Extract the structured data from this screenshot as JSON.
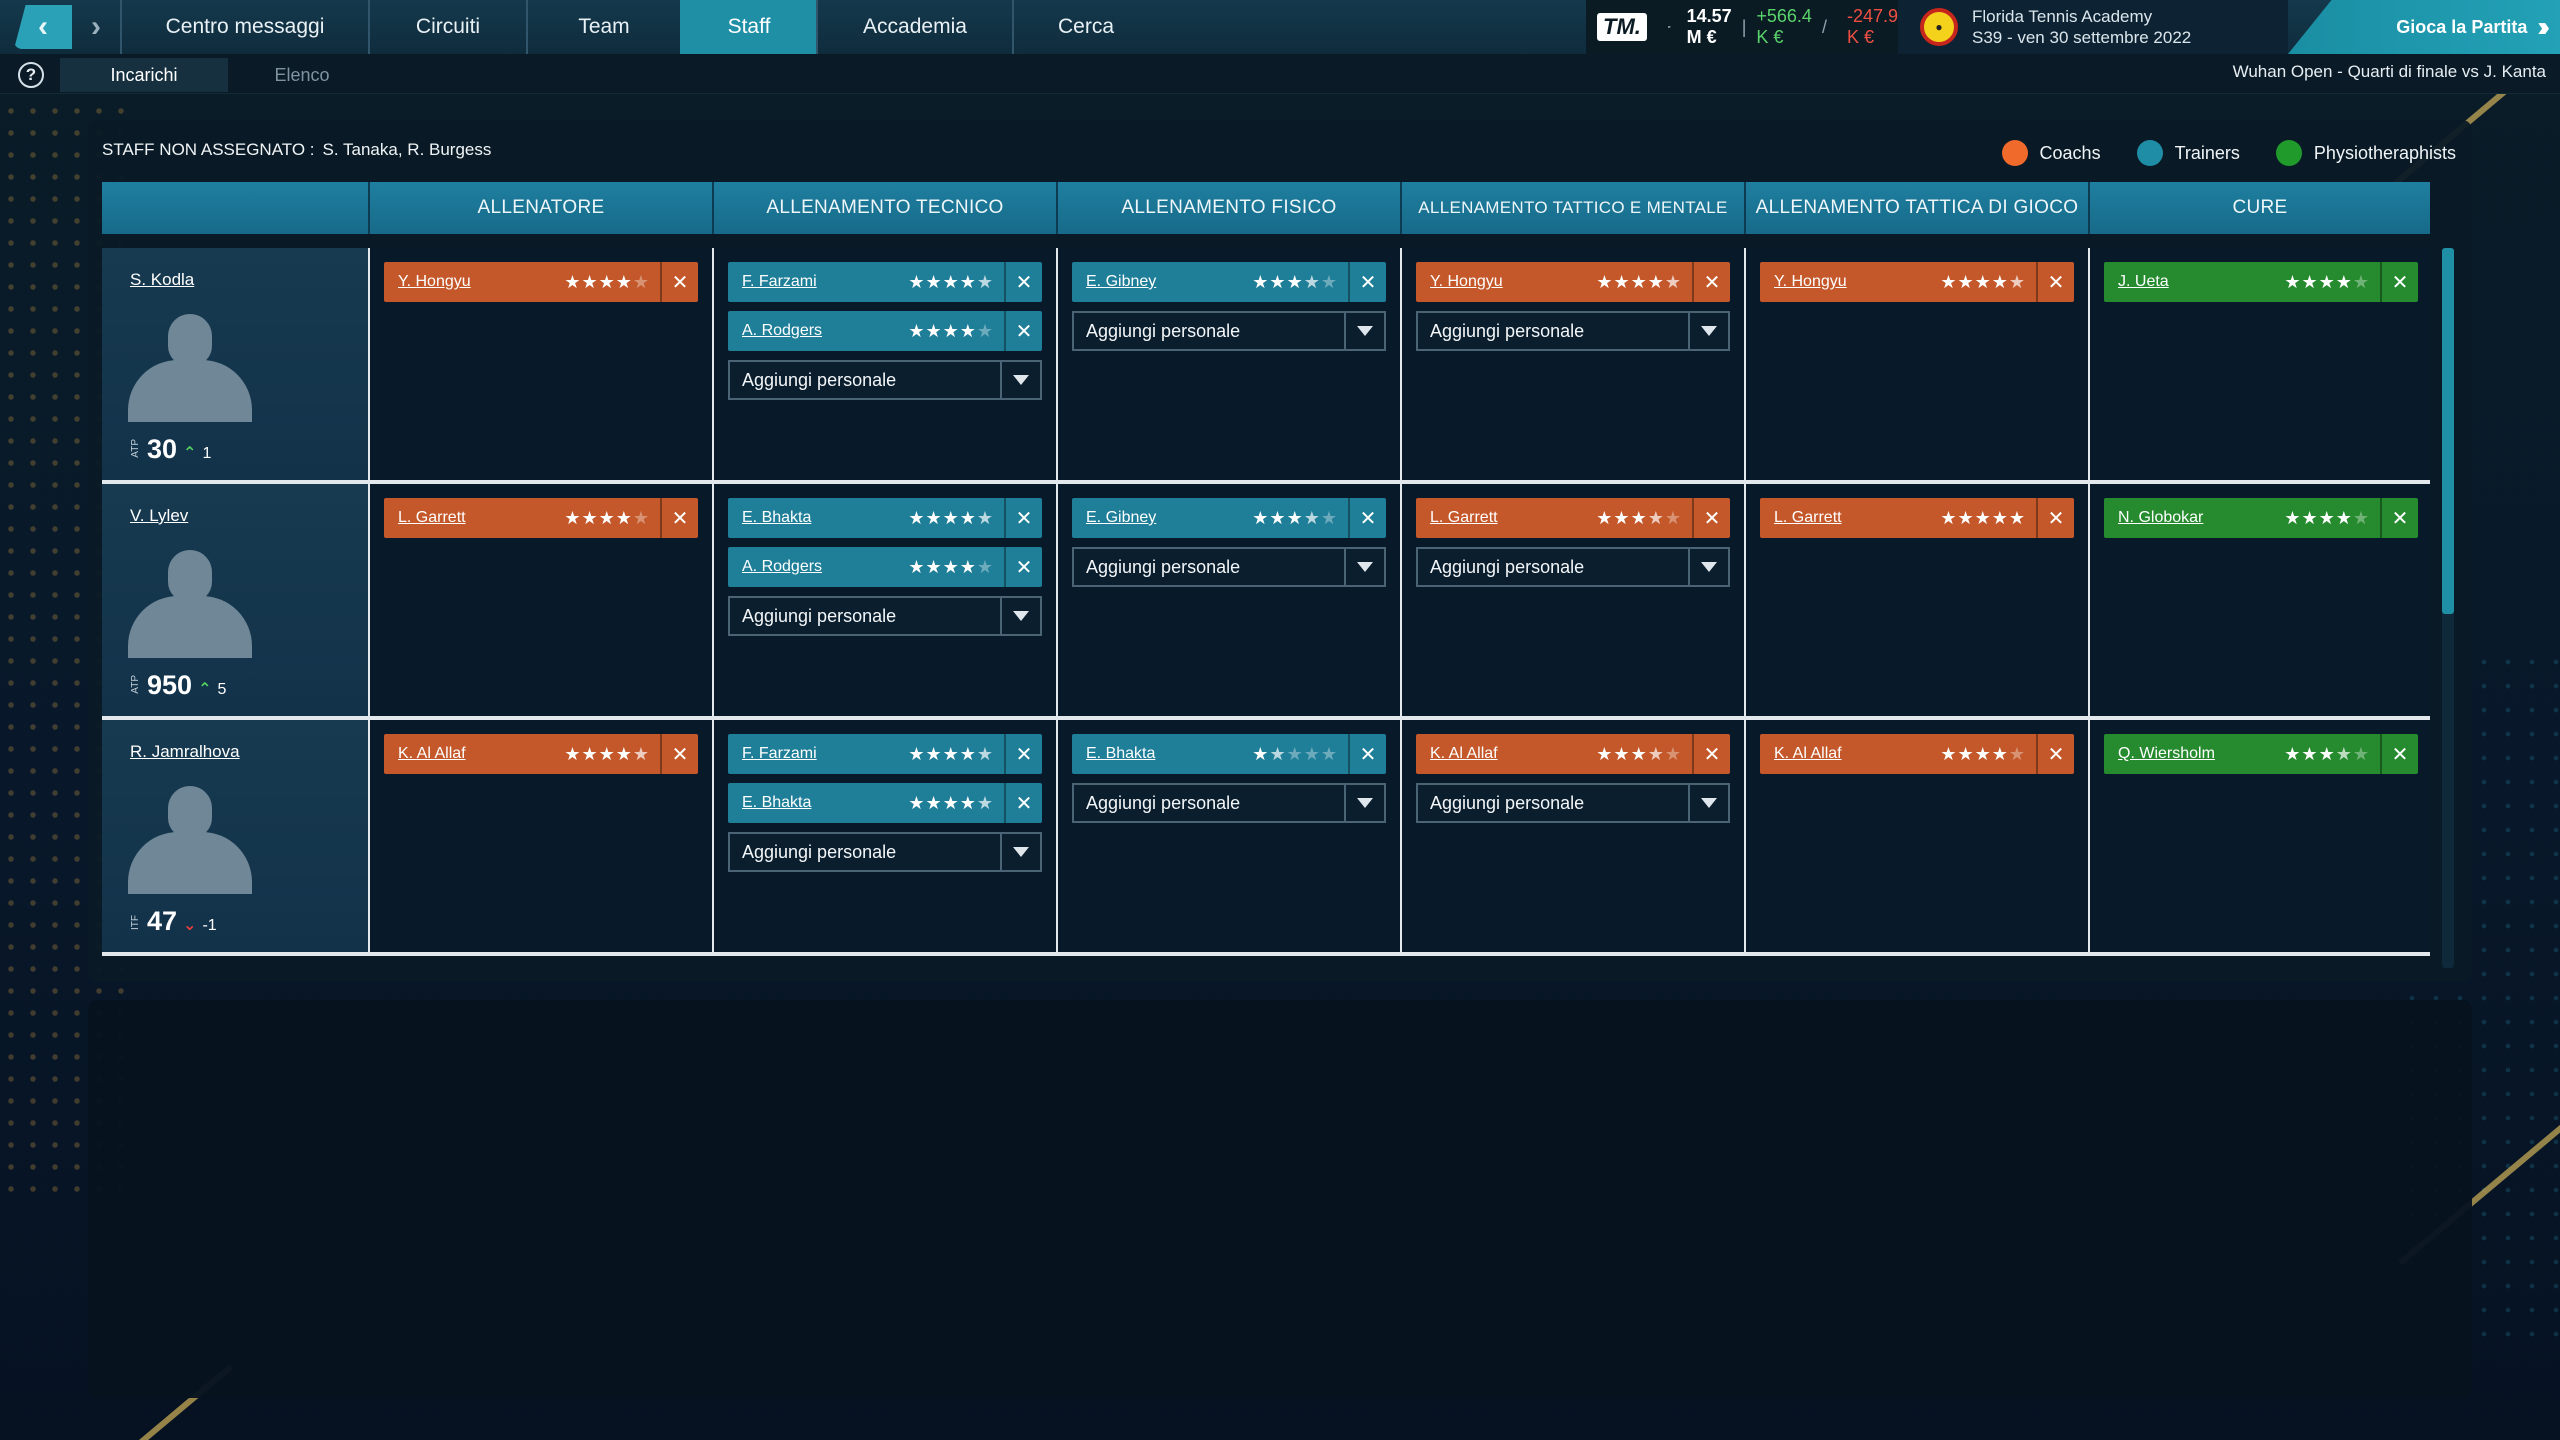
{
  "topbar": {
    "menu": [
      "Centro messaggi",
      "Circuiti",
      "Team",
      "Staff",
      "Accademia",
      "Cerca"
    ],
    "active_menu": "Staff",
    "logo_text": "TM.",
    "balance": "14.57 M €",
    "separator": "|",
    "income": "+566.4 K €",
    "slash": "/",
    "expenses": "-247.9 K €",
    "academy_name": "Florida Tennis Academy",
    "date": "S39 - ven 30 settembre 2022",
    "play_label": "Gioca la Partita"
  },
  "subbar": {
    "help": "?",
    "tab_active": "Incarichi",
    "tab_inactive": "Elenco",
    "match_info": "Wuhan Open - Quarti di finale vs J. Kanta"
  },
  "unassigned": {
    "label": "STAFF NON ASSEGNATO :",
    "names": "S. Tanaka, R. Burgess"
  },
  "legend": [
    {
      "label": "Coachs",
      "color": "#ef6a2b"
    },
    {
      "label": "Trainers",
      "color": "#1f8da6"
    },
    {
      "label": "Physiotheraphists",
      "color": "#1f9a2b"
    }
  ],
  "columns": [
    "",
    "ALLENATORE",
    "ALLENAMENTO TECNICO",
    "ALLENAMENTO FISICO",
    "ALLENAMENTO TATTICO E MENTALE",
    "ALLENAMENTO TATTICA DI GIOCO",
    "CURE"
  ],
  "add_label": "Aggiungi personale",
  "rows": [
    {
      "player": "S. Kodla",
      "rank_label": "ATP",
      "rank": "30",
      "trend": "up",
      "change": "1",
      "cells": [
        {
          "chips": [
            {
              "name": "Y. Hongyu",
              "type": "coach",
              "rating": 4
            }
          ],
          "add": false
        },
        {
          "chips": [
            {
              "name": "F. Farzami",
              "type": "trainer",
              "rating": 4.5
            },
            {
              "name": "A. Rodgers",
              "type": "trainer",
              "rating": 4
            }
          ],
          "add": true
        },
        {
          "chips": [
            {
              "name": "E. Gibney",
              "type": "trainer",
              "rating": 3.5
            }
          ],
          "add": true
        },
        {
          "chips": [
            {
              "name": "Y. Hongyu",
              "type": "coach",
              "rating": 4.5
            }
          ],
          "add": true
        },
        {
          "chips": [
            {
              "name": "Y. Hongyu",
              "type": "coach",
              "rating": 4.5
            }
          ],
          "add": false
        },
        {
          "chips": [
            {
              "name": "J. Ueta",
              "type": "physio",
              "rating": 4
            }
          ],
          "add": false
        }
      ]
    },
    {
      "player": "V. Lylev",
      "rank_label": "ATP",
      "rank": "950",
      "trend": "up",
      "change": "5",
      "cells": [
        {
          "chips": [
            {
              "name": "L. Garrett",
              "type": "coach",
              "rating": 4
            }
          ],
          "add": false
        },
        {
          "chips": [
            {
              "name": "E. Bhakta",
              "type": "trainer",
              "rating": 4.5
            },
            {
              "name": "A. Rodgers",
              "type": "trainer",
              "rating": 4
            }
          ],
          "add": true
        },
        {
          "chips": [
            {
              "name": "E. Gibney",
              "type": "trainer",
              "rating": 3.5
            }
          ],
          "add": true
        },
        {
          "chips": [
            {
              "name": "L. Garrett",
              "type": "coach",
              "rating": 3.5
            }
          ],
          "add": true
        },
        {
          "chips": [
            {
              "name": "L. Garrett",
              "type": "coach",
              "rating": 5
            }
          ],
          "add": false
        },
        {
          "chips": [
            {
              "name": "N. Globokar",
              "type": "physio",
              "rating": 4
            }
          ],
          "add": false
        }
      ]
    },
    {
      "player": "R. Jamralhova",
      "rank_label": "ITF",
      "rank": "47",
      "trend": "down",
      "change": "-1",
      "cells": [
        {
          "chips": [
            {
              "name": "K. Al Allaf",
              "type": "coach",
              "rating": 4.5
            }
          ],
          "add": false
        },
        {
          "chips": [
            {
              "name": "F. Farzami",
              "type": "trainer",
              "rating": 4.5
            },
            {
              "name": "E. Bhakta",
              "type": "trainer",
              "rating": 4.5
            }
          ],
          "add": true
        },
        {
          "chips": [
            {
              "name": "E. Bhakta",
              "type": "trainer",
              "rating": 1.5
            }
          ],
          "add": true
        },
        {
          "chips": [
            {
              "name": "K. Al Allaf",
              "type": "coach",
              "rating": 3.5
            }
          ],
          "add": true
        },
        {
          "chips": [
            {
              "name": "K. Al Allaf",
              "type": "coach",
              "rating": 4
            }
          ],
          "add": false
        },
        {
          "chips": [
            {
              "name": "Q. Wiersholm",
              "type": "physio",
              "rating": 3.5
            }
          ],
          "add": false
        }
      ]
    }
  ],
  "icons": {
    "back": "chevron-left-icon",
    "forward": "chevron-right-icon",
    "money": "cash-icon",
    "close": "close-icon",
    "caret": "caret-down-icon",
    "play": "double-chevron-right-icon"
  }
}
